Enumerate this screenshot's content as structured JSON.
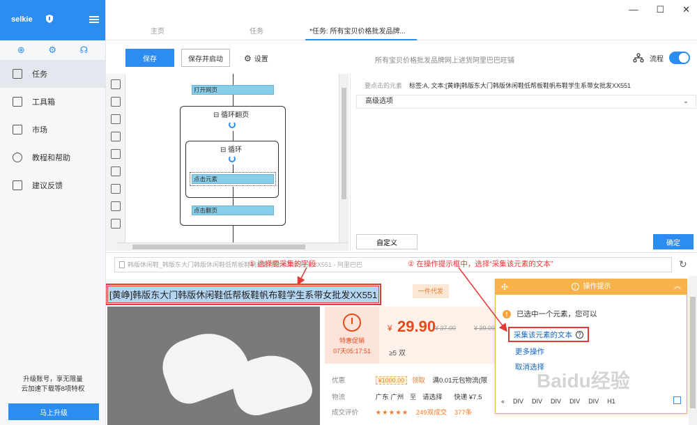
{
  "app": {
    "brand": "selkie",
    "window_controls": [
      "—",
      "☐",
      "✕"
    ]
  },
  "sidebar": {
    "items": [
      {
        "label": "任务",
        "active": true
      },
      {
        "label": "工具箱"
      },
      {
        "label": "市场"
      },
      {
        "label": "教程和帮助"
      },
      {
        "label": "建议反馈"
      }
    ],
    "upgrade_line1": "升级账号，享无限量",
    "upgrade_line2": "云加速下载等8项特权",
    "upgrade_button": "马上升级"
  },
  "tabs": [
    {
      "label": "主页"
    },
    {
      "label": "任务"
    },
    {
      "label": "*任务: 所有宝贝价格批发品牌...",
      "active": true
    }
  ],
  "toolbar": {
    "save_label": "保存",
    "save_start_label": "保存并启动",
    "settings_label": "设置",
    "task_title": "所有宝贝价格批发品牌网上进货阿里巴巴旺铺",
    "flow_label": "流程",
    "flow_enabled": true
  },
  "flow": {
    "open_page": "打开网页",
    "loop_pages": "循环翻页",
    "loop": "循环",
    "click_element": "点击元素",
    "click_next": "点击翻页",
    "collapse_glyph": "⊟"
  },
  "config": {
    "label": "要点击的元素",
    "value": "标签:A, 文本:[黄峥]韩版东大门韩版休闲鞋低帮板鞋帆布鞋学生系带女批发XX551",
    "advanced": "高级选项",
    "custom_button": "自定义",
    "ok_button": "确定"
  },
  "address": {
    "url_text": "韩版休闲鞋_韩版东大门韩版休闲鞋低帮板鞋帆布鞋学生系带女批发XX551 - 阿里巴巴"
  },
  "annotations": {
    "step1": "① 选择要采集的字段",
    "step2": "② 在操作提示框中，选择“采集该元素的文本”"
  },
  "product": {
    "title": "[黄峥]韩版东大门韩版休闲鞋低帮板鞋帆布鞋学生系带女批发XX551",
    "dropship_badge": "一件代发",
    "promo_label": "特惠促销",
    "promo_time": "07天05:17:51",
    "currency": "¥",
    "price": "29.90",
    "old_price_1": "¥ 37.00",
    "old_price_2": "¥ 39.00",
    "moq": "≥5 双",
    "rows": {
      "benefit_label": "优惠",
      "coupon": "¥1000.00",
      "coupon_get": "领取",
      "benefit_text": "满0.01元包物流(限",
      "logistics_label": "物流",
      "logistics_from": "广东 广州",
      "logistics_to": "至",
      "logistics_select": "请选择",
      "logistics_express": "快递 ¥7.5",
      "rating_label": "成交评价",
      "rating_stars": "★★★★★",
      "rating_count": "249双成交",
      "rating_extra": "377条"
    }
  },
  "hint": {
    "title": "操作提示",
    "message": "已选中一个元素，您可以",
    "collect_text": "采集该元素的文本",
    "more_actions": "更多操作",
    "cancel_select": "取消选择",
    "path": [
      "«",
      "DIV",
      "DIV",
      "DIV",
      "DIV",
      "DIV",
      "H1"
    ]
  },
  "watermark": "Baidu经验",
  "colors": {
    "primary": "#2d8cf0",
    "hint_header": "#f7b34a",
    "annotation": "#e53935",
    "price": "#e64a19"
  }
}
